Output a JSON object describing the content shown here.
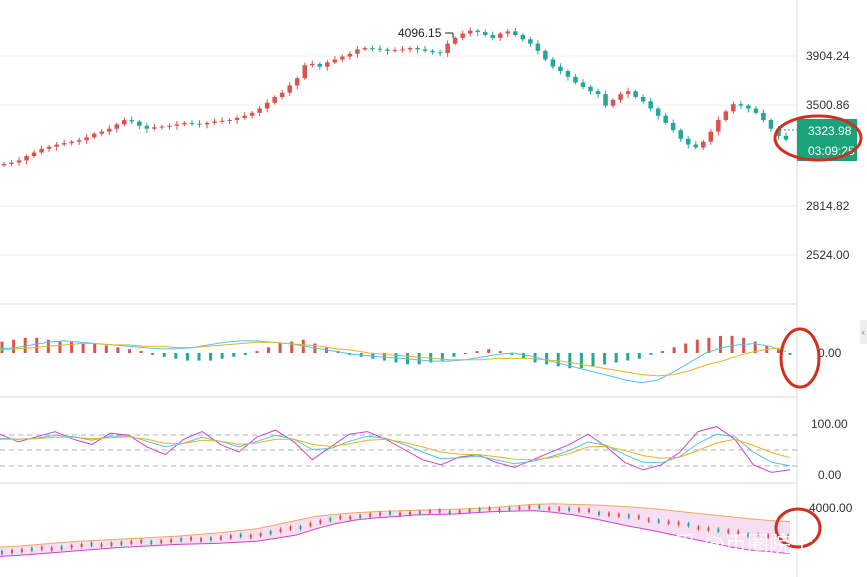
{
  "colors": {
    "up": "#d9534f",
    "down": "#26a69a",
    "grid": "#eeeeee",
    "divider": "#d9d9d9",
    "axis_text": "#333333",
    "macd_fast": "#4fc3f7",
    "macd_slow": "#e6b422",
    "kdj_k": "#5bc0de",
    "kdj_d": "#e6b422",
    "kdj_j": "#cc44cc",
    "band_upper": "#f0a860",
    "band_lower": "#cc44cc",
    "band_fill": "#f5d6f0",
    "highlight": "#d0301e",
    "price_tag": "#1aa37a"
  },
  "main": {
    "y_ticks": [
      "3904.24",
      "3500.86",
      "2814.82",
      "2524.00"
    ],
    "high_label": "4096.15",
    "last_price": "3323.98",
    "countdown": "03:09:25"
  },
  "macd": {
    "y_ticks": [
      "0.00"
    ]
  },
  "kdj": {
    "y_ticks": [
      "100.00",
      "0.00"
    ]
  },
  "bottom": {
    "y_ticks": [
      "4000.00"
    ]
  },
  "watermark": "知乎 @币圈院士",
  "chart_data": [
    {
      "type": "candlestick",
      "panel": "price",
      "y_ticks": [
        3904.24,
        3500.86,
        2814.82,
        2524.0
      ],
      "annotations": [
        "4096.15"
      ],
      "last_price": 3323.98,
      "countdown": "03:09:25",
      "close": [
        3156,
        3165,
        3180,
        3210,
        3235,
        3260,
        3275,
        3290,
        3300,
        3310,
        3320,
        3340,
        3365,
        3380,
        3400,
        3430,
        3460,
        3450,
        3420,
        3400,
        3410,
        3415,
        3420,
        3430,
        3440,
        3435,
        3430,
        3440,
        3450,
        3455,
        3460,
        3475,
        3490,
        3510,
        3540,
        3580,
        3620,
        3650,
        3700,
        3750,
        3840,
        3850,
        3830,
        3860,
        3880,
        3900,
        3920,
        3950,
        3960,
        3955,
        3950,
        3940,
        3945,
        3950,
        3960,
        3950,
        3940,
        3930,
        3925,
        3990,
        4030,
        4060,
        4080,
        4070,
        4050,
        4030,
        4060,
        4075,
        4050,
        4020,
        3990,
        3940,
        3880,
        3830,
        3800,
        3760,
        3720,
        3690,
        3660,
        3640,
        3560,
        3600,
        3640,
        3660,
        3620,
        3590,
        3540,
        3490,
        3440,
        3390,
        3330,
        3290,
        3270,
        3310,
        3380,
        3460,
        3520,
        3570,
        3560,
        3540,
        3510,
        3460,
        3400,
        3350,
        3324
      ]
    },
    {
      "type": "bar+line",
      "panel": "macd",
      "y_ticks": [
        0.0
      ],
      "histogram": [
        6,
        7,
        8,
        8,
        7,
        6,
        6,
        5,
        5,
        4,
        3,
        2,
        1,
        -1,
        -2,
        -3,
        -4,
        -4,
        -4,
        -3,
        -2,
        -1,
        1,
        3,
        5,
        6,
        7,
        5,
        3,
        1,
        -1,
        -2,
        -3,
        -4,
        -5,
        -6,
        -6,
        -5,
        -4,
        -2,
        0,
        1,
        2,
        1,
        -1,
        -3,
        -5,
        -6,
        -7,
        -8,
        -8,
        -7,
        -6,
        -5,
        -4,
        -3,
        -1,
        1,
        3,
        5,
        7,
        8,
        9,
        9,
        8,
        6,
        4,
        2,
        -1
      ],
      "fast": [
        3,
        4,
        6,
        8,
        9,
        8,
        7,
        6,
        5,
        4,
        3,
        3,
        4,
        6,
        8,
        9,
        9,
        8,
        7,
        5,
        3,
        1,
        -1,
        -2,
        -3,
        -4,
        -5,
        -6,
        -6,
        -5,
        -3,
        -1,
        0,
        -2,
        -5,
        -8,
        -11,
        -14,
        -17,
        -20,
        -22,
        -20,
        -14,
        -7,
        0,
        4,
        6,
        7,
        5,
        1
      ],
      "slow": [
        2,
        3,
        4,
        5,
        6,
        7,
        7,
        6,
        6,
        5,
        5,
        4,
        4,
        5,
        6,
        7,
        8,
        8,
        7,
        6,
        5,
        3,
        2,
        0,
        -1,
        -2,
        -3,
        -4,
        -5,
        -5,
        -5,
        -4,
        -4,
        -4,
        -5,
        -6,
        -8,
        -10,
        -12,
        -14,
        -16,
        -17,
        -16,
        -13,
        -9,
        -6,
        -2,
        1,
        3,
        4
      ]
    },
    {
      "type": "line",
      "panel": "kdj",
      "y_ticks": [
        100.0,
        0.0
      ],
      "series": [
        {
          "values": [
            80,
            65,
            75,
            85,
            70,
            60,
            82,
            78,
            55,
            40,
            70,
            85,
            60,
            45,
            75,
            88,
            65,
            30,
            55,
            80,
            85,
            70,
            50,
            30,
            20,
            35,
            40,
            25,
            15,
            30,
            45,
            60,
            80,
            55,
            25,
            10,
            20,
            45,
            85,
            95,
            70,
            20,
            5,
            10
          ]
        },
        {
          "values": [
            72,
            70,
            72,
            78,
            75,
            68,
            76,
            77,
            66,
            55,
            62,
            74,
            66,
            55,
            66,
            78,
            70,
            50,
            52,
            66,
            76,
            72,
            60,
            45,
            32,
            34,
            37,
            30,
            22,
            27,
            36,
            48,
            65,
            58,
            40,
            25,
            24,
            36,
            62,
            80,
            75,
            45,
            25,
            18
          ]
        },
        {
          "values": [
            70,
            70,
            71,
            74,
            74,
            71,
            73,
            75,
            70,
            62,
            62,
            68,
            66,
            60,
            63,
            70,
            70,
            60,
            56,
            61,
            68,
            70,
            64,
            55,
            45,
            41,
            40,
            36,
            31,
            30,
            34,
            42,
            55,
            56,
            48,
            38,
            33,
            35,
            48,
            63,
            70,
            58,
            44,
            34
          ]
        }
      ]
    },
    {
      "type": "area",
      "panel": "band",
      "y_ticks": [
        4000.0
      ],
      "series": [
        {
          "values": [
            3250,
            3270,
            3300,
            3330,
            3360,
            3380,
            3400,
            3420,
            3440,
            3460,
            3490,
            3520,
            3560,
            3600,
            3680,
            3760,
            3840,
            3880,
            3910,
            3930,
            3945,
            3955,
            3965,
            3975,
            3990,
            4010,
            4040,
            4070,
            4080,
            4070,
            4060,
            4040,
            4020,
            3990,
            3950,
            3910,
            3870,
            3830,
            3790,
            3760,
            3740
          ]
        },
        {
          "values": [
            3160,
            3180,
            3210,
            3240,
            3270,
            3300,
            3320,
            3340,
            3360,
            3380,
            3400,
            3420,
            3450,
            3480,
            3550,
            3620,
            3720,
            3790,
            3840,
            3870,
            3890,
            3910,
            3920,
            3930,
            3950,
            3970,
            3990,
            4010,
            4000,
            3970,
            3930,
            3880,
            3830,
            3780,
            3720,
            3660,
            3600,
            3540,
            3490,
            3460,
            3430
          ]
        },
        {
          "values": [
            3070,
            3090,
            3120,
            3150,
            3180,
            3210,
            3240,
            3260,
            3280,
            3300,
            3310,
            3320,
            3340,
            3360,
            3420,
            3480,
            3600,
            3700,
            3770,
            3810,
            3835,
            3865,
            3875,
            3885,
            3910,
            3930,
            3940,
            3950,
            3920,
            3870,
            3800,
            3720,
            3640,
            3570,
            3490,
            3410,
            3330,
            3250,
            3190,
            3160,
            3120
          ]
        }
      ]
    }
  ]
}
